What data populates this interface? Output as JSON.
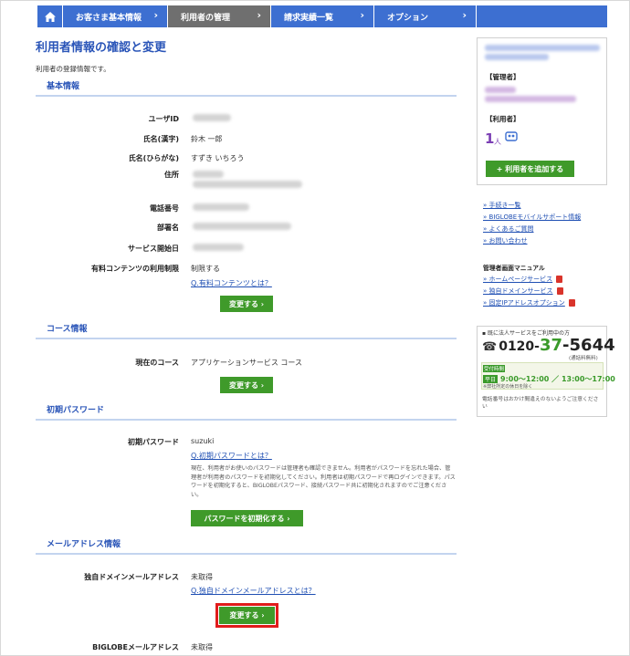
{
  "nav": {
    "tabs": [
      {
        "label": "お客さま基本情報"
      },
      {
        "label": "利用者の管理"
      },
      {
        "label": "請求実績一覧"
      },
      {
        "label": "オプション"
      }
    ]
  },
  "page": {
    "title": "利用者情報の確認と変更",
    "description": "利用者の登録情報です。"
  },
  "sections": {
    "basic": "基本情報",
    "course": "コース情報",
    "password": "初期パスワード",
    "mail": "メールアドレス情報"
  },
  "basic": {
    "user_id_label": "ユーザID",
    "name_kanji_label": "氏名(漢字)",
    "name_kanji_value": "鈴木 一郎",
    "name_kana_label": "氏名(ひらがな)",
    "name_kana_value": "すずき いちろう",
    "address_label": "住所",
    "phone_label": "電話番号",
    "dept_label": "部署名",
    "start_label": "サービス開始日",
    "paid_label": "有料コンテンツの利用制限",
    "paid_value": "制限する",
    "paid_link": "Q.有料コンテンツとは？",
    "change_button": "変更する ›"
  },
  "course": {
    "label": "現在のコース",
    "value": "アプリケーションサービス コース",
    "change_button": "変更する ›"
  },
  "password": {
    "label": "初期パスワード",
    "value": "suzuki",
    "link": "Q.初期パスワードとは？",
    "note": "現在、利用者がお使いのパスワードは管理者も確認できません。利用者がパスワードを忘れた場合、管理者が利用者のパスワードを初期化してください。利用者は初期パスワードで再ログインできます。パスワードを初期化すると、BIGLOBEパスワード、接続パスワード共に初期化されますのでご注意ください。",
    "init_button": "パスワードを初期化する ›"
  },
  "mail": {
    "own_domain_label": "独自ドメインメールアドレス",
    "own_domain_value": "未取得",
    "own_domain_link": "Q.独自ドメインメールアドレスとは？",
    "change_button": "変更する ›",
    "biglobe_label": "BIGLOBEメールアドレス",
    "biglobe_value": "未取得"
  },
  "sidebar": {
    "admin_label": "【管理者】",
    "users_label": "【利用者】",
    "user_count": "1",
    "user_unit": "人",
    "add_user_button": "+ 利用者を追加する",
    "links": [
      "手続き一覧",
      "BIGLOBEモバイルサポート情報",
      "よくあるご質問",
      "お問い合わせ"
    ],
    "manual_title": "管理者画面マニュアル",
    "manual_links": [
      "ホームページサービス",
      "独自ドメインサービス",
      "固定IPアドレスオプション"
    ],
    "tel_caption": "▪ 既に法人サービスをご利用中の方",
    "tel_prefix": "0120-",
    "tel_mid": "37",
    "tel_suffix": "-5644",
    "tel_note": "(通話料無料)",
    "hours_title": "受付時間",
    "hours_badge": "平日",
    "hours_value": "9:00～12:00 ／ 13:00～17:00",
    "hours_note": "※弊社所定の休日を除く",
    "tel_warning": "電話番号はおかけ間違えのないようご注意ください"
  },
  "colors": {
    "nav_blue": "#3d6fd1",
    "nav_active": "#6f6f6f",
    "button_green": "#3f9a2a",
    "highlight_red": "#e11c1c",
    "title_blue": "#2a55b8"
  }
}
